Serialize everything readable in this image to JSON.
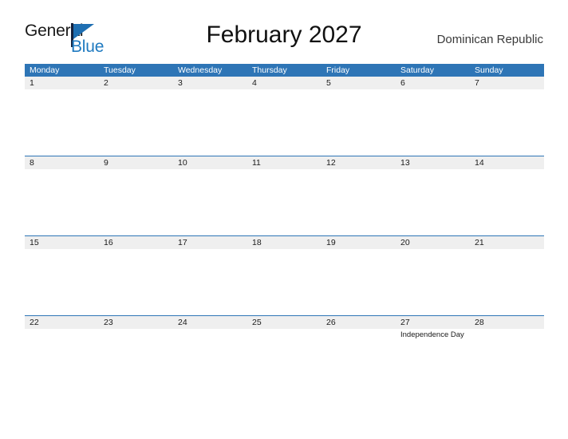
{
  "brand": {
    "name_top": "General",
    "name_bottom": "Blue",
    "mark": "triangle-flag-logo",
    "color_dark": "#14213d",
    "color_blue": "#1f7ac0"
  },
  "header": {
    "title": "February 2027",
    "region": "Dominican Republic"
  },
  "theme": {
    "header_blue": "#2e75b6",
    "date_strip_gray": "#efefef",
    "text_dark": "#1a1a1a",
    "page_bg": "#ffffff"
  },
  "calendar": {
    "month": "February",
    "year": "2027",
    "weekday_headers": [
      "Monday",
      "Tuesday",
      "Wednesday",
      "Thursday",
      "Friday",
      "Saturday",
      "Sunday"
    ],
    "weeks": [
      {
        "days": [
          {
            "date": "1",
            "events": []
          },
          {
            "date": "2",
            "events": []
          },
          {
            "date": "3",
            "events": []
          },
          {
            "date": "4",
            "events": []
          },
          {
            "date": "5",
            "events": []
          },
          {
            "date": "6",
            "events": []
          },
          {
            "date": "7",
            "events": []
          }
        ]
      },
      {
        "days": [
          {
            "date": "8",
            "events": []
          },
          {
            "date": "9",
            "events": []
          },
          {
            "date": "10",
            "events": []
          },
          {
            "date": "11",
            "events": []
          },
          {
            "date": "12",
            "events": []
          },
          {
            "date": "13",
            "events": []
          },
          {
            "date": "14",
            "events": []
          }
        ]
      },
      {
        "days": [
          {
            "date": "15",
            "events": []
          },
          {
            "date": "16",
            "events": []
          },
          {
            "date": "17",
            "events": []
          },
          {
            "date": "18",
            "events": []
          },
          {
            "date": "19",
            "events": []
          },
          {
            "date": "20",
            "events": []
          },
          {
            "date": "21",
            "events": []
          }
        ]
      },
      {
        "days": [
          {
            "date": "22",
            "events": []
          },
          {
            "date": "23",
            "events": []
          },
          {
            "date": "24",
            "events": []
          },
          {
            "date": "25",
            "events": []
          },
          {
            "date": "26",
            "events": []
          },
          {
            "date": "27",
            "events": [
              "Independence Day"
            ]
          },
          {
            "date": "28",
            "events": []
          }
        ]
      }
    ]
  }
}
